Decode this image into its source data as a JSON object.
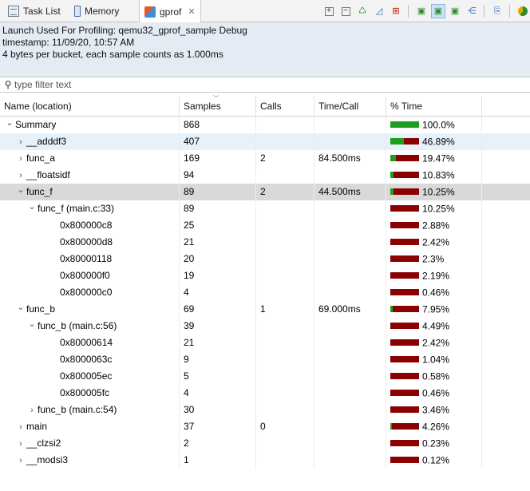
{
  "tabs": [
    {
      "label": "Task List",
      "icon": "task-list-icon"
    },
    {
      "label": "Memory",
      "icon": "memory-icon"
    },
    {
      "label": "gprof",
      "icon": "gprof-icon",
      "close": "✕"
    }
  ],
  "info": {
    "launch": "Launch Used For Profiling: qemu32_gprof_sample Debug",
    "timestamp": "timestamp: 11/09/20, 10:57 AM",
    "bucket": "4 bytes per bucket, each sample counts as 1.000ms"
  },
  "filter": {
    "placeholder": "type filter text",
    "value": ""
  },
  "columns": [
    "Name (location)",
    "Samples",
    "Calls",
    "Time/Call",
    "% Time"
  ],
  "colors": {
    "bar_green": "#1e9e1e",
    "bar_red": "#8b0000",
    "header_bg": "#e5ebf3",
    "row_highlight_blue": "#e6f2fb",
    "row_highlight_gray": "#d9d9d9"
  },
  "rows": [
    {
      "name": "Summary",
      "level": 0,
      "expander": "expanded",
      "samples": "868",
      "calls": "",
      "time_call": "",
      "pct": "100.0%",
      "pct_value": 100.0,
      "bar": "green",
      "highlight": ""
    },
    {
      "name": "__adddf3",
      "level": 1,
      "expander": "collapsed",
      "samples": "407",
      "calls": "",
      "time_call": "",
      "pct": "46.89%",
      "pct_value": 46.89,
      "bar": "red",
      "highlight": "blue"
    },
    {
      "name": "func_a",
      "level": 1,
      "expander": "collapsed",
      "samples": "169",
      "calls": "2",
      "time_call": "84.500ms",
      "pct": "19.47%",
      "pct_value": 19.47,
      "bar": "red",
      "highlight": ""
    },
    {
      "name": "__floatsidf",
      "level": 1,
      "expander": "collapsed",
      "samples": "94",
      "calls": "",
      "time_call": "",
      "pct": "10.83%",
      "pct_value": 10.83,
      "bar": "red",
      "highlight": ""
    },
    {
      "name": "func_f",
      "level": 1,
      "expander": "expanded",
      "samples": "89",
      "calls": "2",
      "time_call": "44.500ms",
      "pct": "10.25%",
      "pct_value": 10.25,
      "bar": "red",
      "highlight": "gray"
    },
    {
      "name": "func_f (main.c:33)",
      "level": 2,
      "expander": "expanded",
      "samples": "89",
      "calls": "",
      "time_call": "",
      "pct": "10.25%",
      "pct_value": 10.25,
      "bar": "red",
      "highlight": ""
    },
    {
      "name": "0x800000c8",
      "level": 4,
      "expander": "none",
      "samples": "25",
      "calls": "",
      "time_call": "",
      "pct": "2.88%",
      "pct_value": 2.88,
      "bar": "red",
      "highlight": ""
    },
    {
      "name": "0x800000d8",
      "level": 4,
      "expander": "none",
      "samples": "21",
      "calls": "",
      "time_call": "",
      "pct": "2.42%",
      "pct_value": 2.42,
      "bar": "red",
      "highlight": ""
    },
    {
      "name": "0x80000118",
      "level": 4,
      "expander": "none",
      "samples": "20",
      "calls": "",
      "time_call": "",
      "pct": "2.3%",
      "pct_value": 2.3,
      "bar": "red",
      "highlight": ""
    },
    {
      "name": "0x800000f0",
      "level": 4,
      "expander": "none",
      "samples": "19",
      "calls": "",
      "time_call": "",
      "pct": "2.19%",
      "pct_value": 2.19,
      "bar": "red",
      "highlight": ""
    },
    {
      "name": "0x800000c0",
      "level": 4,
      "expander": "none",
      "samples": "4",
      "calls": "",
      "time_call": "",
      "pct": "0.46%",
      "pct_value": 0.46,
      "bar": "red",
      "highlight": ""
    },
    {
      "name": "func_b",
      "level": 1,
      "expander": "expanded",
      "samples": "69",
      "calls": "1",
      "time_call": "69.000ms",
      "pct": "7.95%",
      "pct_value": 7.95,
      "bar": "red",
      "highlight": ""
    },
    {
      "name": "func_b (main.c:56)",
      "level": 2,
      "expander": "expanded",
      "samples": "39",
      "calls": "",
      "time_call": "",
      "pct": "4.49%",
      "pct_value": 4.49,
      "bar": "red",
      "highlight": ""
    },
    {
      "name": "0x80000614",
      "level": 4,
      "expander": "none",
      "samples": "21",
      "calls": "",
      "time_call": "",
      "pct": "2.42%",
      "pct_value": 2.42,
      "bar": "red",
      "highlight": ""
    },
    {
      "name": "0x8000063c",
      "level": 4,
      "expander": "none",
      "samples": "9",
      "calls": "",
      "time_call": "",
      "pct": "1.04%",
      "pct_value": 1.04,
      "bar": "red",
      "highlight": ""
    },
    {
      "name": "0x800005ec",
      "level": 4,
      "expander": "none",
      "samples": "5",
      "calls": "",
      "time_call": "",
      "pct": "0.58%",
      "pct_value": 0.58,
      "bar": "red",
      "highlight": ""
    },
    {
      "name": "0x800005fc",
      "level": 4,
      "expander": "none",
      "samples": "4",
      "calls": "",
      "time_call": "",
      "pct": "0.46%",
      "pct_value": 0.46,
      "bar": "red",
      "highlight": ""
    },
    {
      "name": "func_b (main.c:54)",
      "level": 2,
      "expander": "collapsed",
      "samples": "30",
      "calls": "",
      "time_call": "",
      "pct": "3.46%",
      "pct_value": 3.46,
      "bar": "red",
      "highlight": ""
    },
    {
      "name": "main",
      "level": 1,
      "expander": "collapsed",
      "samples": "37",
      "calls": "0",
      "time_call": "",
      "pct": "4.26%",
      "pct_value": 4.26,
      "bar": "red",
      "highlight": ""
    },
    {
      "name": "__clzsi2",
      "level": 1,
      "expander": "collapsed",
      "samples": "2",
      "calls": "",
      "time_call": "",
      "pct": "0.23%",
      "pct_value": 0.23,
      "bar": "red",
      "highlight": ""
    },
    {
      "name": "__modsi3",
      "level": 1,
      "expander": "collapsed",
      "samples": "1",
      "calls": "",
      "time_call": "",
      "pct": "0.12%",
      "pct_value": 0.12,
      "bar": "red",
      "highlight": ""
    }
  ]
}
